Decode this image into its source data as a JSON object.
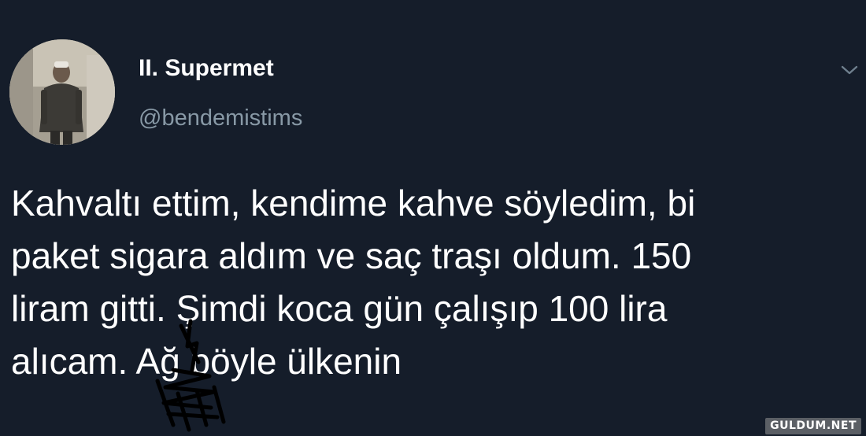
{
  "author": {
    "display_name": "II. Supermet",
    "handle": "@bendemistims"
  },
  "tweet": {
    "lines": [
      "Kahvaltı ettim, kendime kahve söyledim, bi",
      "paket sigara aldım ve saç traşı oldum. 150",
      "liram gitti. Şimdi koca gün çalışıp 100 lira",
      "alıcam. Ağ böyle ülkenin"
    ]
  },
  "icons": {
    "menu": "chevron-down-icon",
    "avatar": "avatar"
  },
  "watermark": "GULDUM.NET",
  "colors": {
    "background": "#151d2a",
    "text": "#ffffff",
    "secondary_text": "#8899a6"
  }
}
